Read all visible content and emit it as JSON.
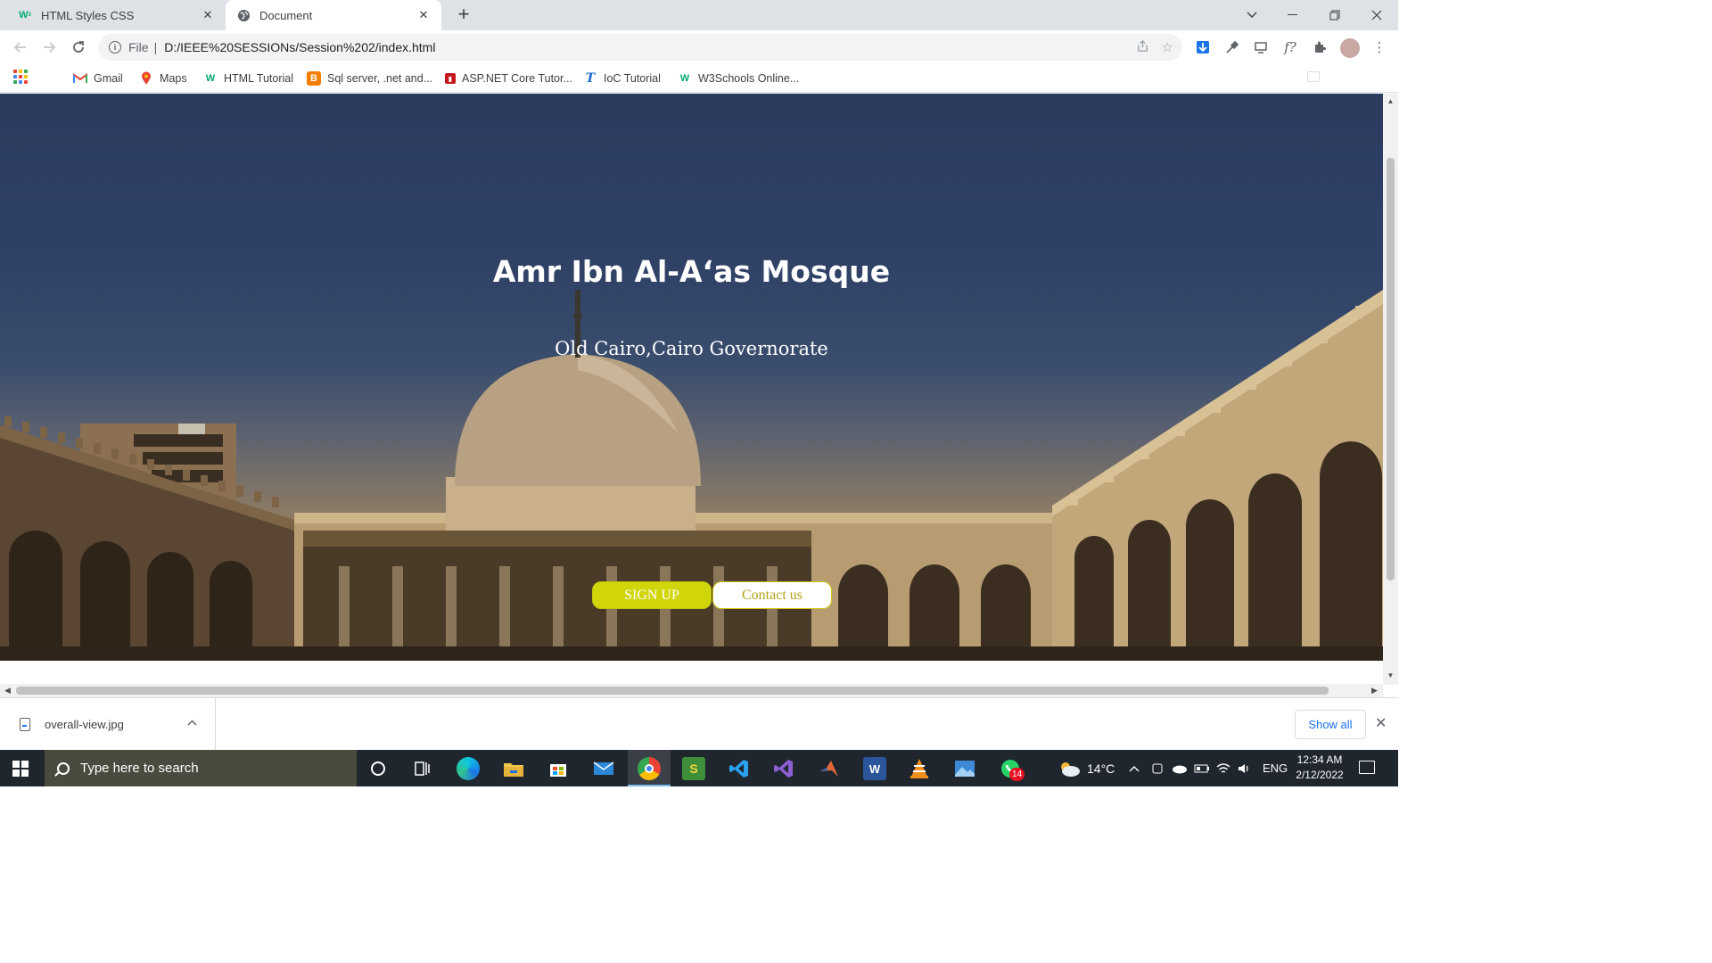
{
  "browser": {
    "tabs": [
      {
        "title": "HTML Styles CSS",
        "favicon": "w3schools-icon"
      },
      {
        "title": "Document",
        "favicon": "globe-icon"
      }
    ],
    "address": {
      "scheme": "File",
      "url": "D:/IEEE%20SESSIONs/Session%202/index.html"
    },
    "bookmarks": [
      {
        "label": "Gmail",
        "icon": "gmail-icon"
      },
      {
        "label": "Maps",
        "icon": "maps-icon"
      },
      {
        "label": "HTML Tutorial",
        "icon": "w3schools-icon"
      },
      {
        "label": "Sql server, .net and...",
        "icon": "blogger-icon"
      },
      {
        "label": "ASP.NET Core Tutor...",
        "icon": "dotnet-tutorials-icon"
      },
      {
        "label": "IoC Tutorial",
        "icon": "tutorialsteacher-icon"
      },
      {
        "label": "W3Schools Online...",
        "icon": "w3schools-icon"
      }
    ]
  },
  "page": {
    "title": "Amr Ibn Al-A‘as Mosque",
    "subtitle": "Old Cairo,Cairo Governorate",
    "signup_label": "SIGN UP",
    "contact_label": "Contact us"
  },
  "downloads": {
    "file_name": "overall-view.jpg",
    "show_all_label": "Show all"
  },
  "taskbar": {
    "search_placeholder": "Type here to search",
    "weather": "14°C",
    "language": "ENG",
    "time": "12:34 AM",
    "date": "2/12/2022",
    "whatsapp_badge": "14"
  },
  "colors": {
    "signup_bg": "#d1d60b",
    "contact_text": "#b5a318",
    "taskbar_bg": "#20262e",
    "tab_strip_bg": "#dee1e6"
  }
}
